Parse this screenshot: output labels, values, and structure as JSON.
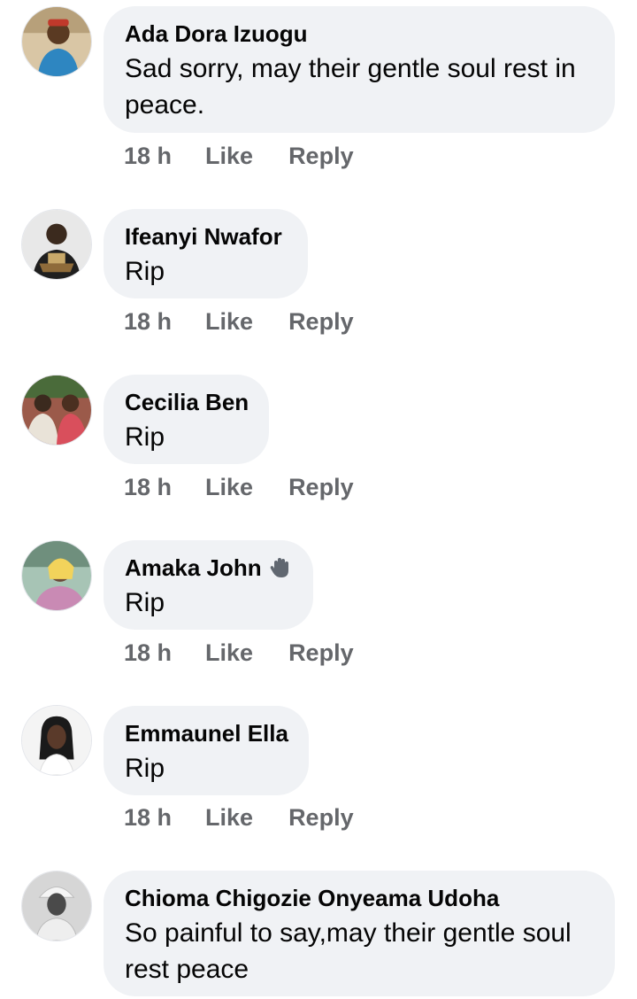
{
  "comments": [
    {
      "name": "Ada Dora Izuogu",
      "text": "Sad sorry, may their gentle soul rest in peace.",
      "time": "18 h",
      "like_label": "Like",
      "reply_label": "Reply"
    },
    {
      "name": "Ifeanyi Nwafor",
      "text": "Rip",
      "time": "18 h",
      "like_label": "Like",
      "reply_label": "Reply"
    },
    {
      "name": "Cecilia Ben",
      "text": "Rip",
      "time": "18 h",
      "like_label": "Like",
      "reply_label": "Reply"
    },
    {
      "name": "Amaka John",
      "badge_icon": "waving-hand-icon",
      "text": "Rip",
      "time": "18 h",
      "like_label": "Like",
      "reply_label": "Reply"
    },
    {
      "name": "Emmaunel Ella",
      "text": "Rip",
      "time": "18 h",
      "like_label": "Like",
      "reply_label": "Reply"
    },
    {
      "name": "Chioma Chigozie Onyeama Udoha",
      "text": "So painful to say,may their gentle soul rest peace"
    }
  ],
  "colors": {
    "bubble_bg": "#f0f2f5",
    "name_text": "#050505",
    "meta_text": "#65676b"
  }
}
